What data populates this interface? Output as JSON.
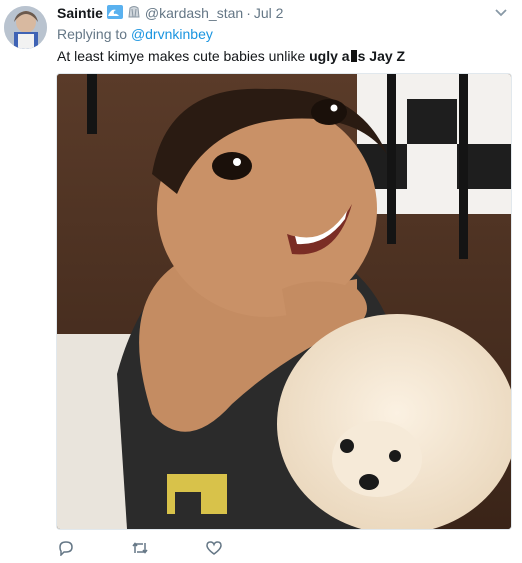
{
  "tweet": {
    "display_name": "Saintie",
    "emojis": [
      "wave-emoji",
      "shell-emoji"
    ],
    "handle": "@kardash_stan",
    "separator": "·",
    "date": "Jul 2",
    "replying_prefix": "Replying to",
    "replying_handle": "@drvnkinbey",
    "text_part1": "At least kimye makes cute babies unlike ",
    "text_bold1": "ugly",
    "text_bold_a": "a",
    "text_bold_s": "s",
    "text_bold2": "Jay Z",
    "media_description": "photo of a smiling girl hugging a white pomeranian puppy"
  },
  "actions": {
    "icons": [
      "reply-icon",
      "retweet-icon",
      "like-icon"
    ]
  },
  "colors": {
    "link": "#1b95e0",
    "secondary_text": "#657786",
    "primary_text": "#14171a"
  }
}
